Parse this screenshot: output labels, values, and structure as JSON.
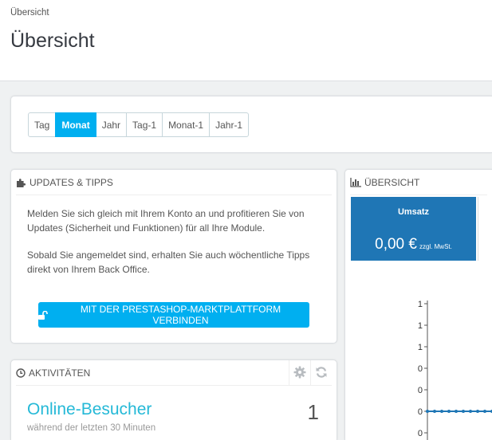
{
  "breadcrumb": "Übersicht",
  "page_title": "Übersicht",
  "period_buttons": [
    {
      "label": "Tag",
      "active": false
    },
    {
      "label": "Monat",
      "active": true
    },
    {
      "label": "Jahr",
      "active": false
    },
    {
      "label": "Tag-1",
      "active": false
    },
    {
      "label": "Monat-1",
      "active": false
    },
    {
      "label": "Jahr-1",
      "active": false
    }
  ],
  "updates": {
    "title": "Updates & Tipps",
    "text1": "Melden Sie sich gleich mit Ihrem Konto an und profitieren Sie von Updates (Sicherheit und Funktionen) für all Ihre Module.",
    "text2": "Sobald Sie angemeldet sind, erhalten Sie auch wöchentliche Tipps direkt von Ihrem Back Office.",
    "connect_button": "Mit der PrestaShop-Marktplattform verbinden"
  },
  "overview": {
    "title": "Übersicht",
    "kpi_label": "Umsatz",
    "kpi_value": "0,00 €",
    "kpi_tax": "zzgl. MwSt."
  },
  "activity": {
    "title": "Aktivitäten",
    "visitors_label": "Online-Besucher",
    "visitors_sub": "während der letzten 30 Minuten",
    "visitors_count": "1"
  },
  "chart_data": {
    "type": "line",
    "y_tick_labels": [
      "1",
      "1",
      "1",
      "0",
      "0",
      "0",
      "0"
    ],
    "series": [
      {
        "values": [
          0,
          0,
          0,
          0,
          0,
          0,
          0,
          0,
          0,
          0,
          0
        ]
      }
    ]
  },
  "colors": {
    "accent": "#00aff0",
    "kpi_bg": "#1f76b5",
    "link": "#25b9d7",
    "line": "#1f76b5"
  },
  "icons": {
    "updates": "puzzle-icon",
    "overview": "bar-chart-icon",
    "activity": "clock-icon",
    "connect": "unlock-icon",
    "settings": "gear-icon",
    "refresh": "refresh-icon"
  }
}
